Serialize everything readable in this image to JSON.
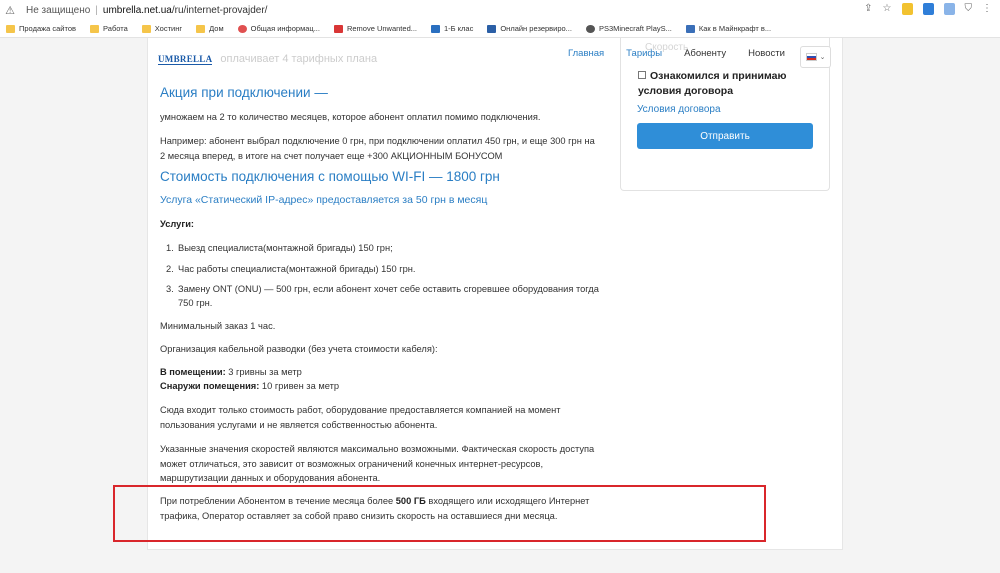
{
  "browser": {
    "security_label": "Не защищено",
    "url_host": "umbrella.net.ua",
    "url_path": "/ru/internet-provajder/",
    "bookmarks": [
      "Продажа сайтов",
      "Работа",
      "Хостинг",
      "Дом",
      "Общая информац...",
      "Remove Unwanted...",
      "1-Б клас",
      "Онлайн резервиро...",
      "PS3Minecraft PlayS...",
      "Как в Майнкрафт в..."
    ]
  },
  "header": {
    "logo_text": "UMBRELLA",
    "faded_text": "оплачивает 4 тарифных плана",
    "nav": [
      "Главная",
      "Тарифы",
      "Абоненту",
      "Новости"
    ]
  },
  "sidebar": {
    "faded_label": "Скорость",
    "agree_text": "Ознакомился и принимаю условия договора",
    "terms_link": "Условия договора",
    "submit_label": "Отправить"
  },
  "main": {
    "promo_title": "Акция при подключении —",
    "promo_p1": "умножаем на 2 то количество месяцев, которое абонент оплатил помимо подключения.",
    "promo_p2_l1": "Например: абонент выбрал подключение 0 грн, при подключении оплатил 450 грн, и еще 300 грн на",
    "promo_p2_l2": "2 месяца вперед, в итоге на счет получает еще +300 АКЦИОННЫМ БОНУСОМ",
    "wifi_title": "Стоимость подключения с помощью WI-FI — 1800 грн",
    "ip_service": "Услуга «Статический IP-адрес» предоставляется за 50 грн в месяц",
    "services_label": "Услуги:",
    "services": [
      {
        "num": "1.",
        "l1": "Выезд специалиста(монтажной бригады) 150 грн;",
        "l2": ""
      },
      {
        "num": "2.",
        "l1": "Час работы специалиста(монтажной бригады) 150 грн.",
        "l2": ""
      },
      {
        "num": "3.",
        "l1": "Замену ONT (ONU) — 500 грн, если абонент хочет себе оставить сгоревшее оборудования тогда",
        "l2": "750 грн."
      }
    ],
    "min_order": "Минимальный заказ 1 час.",
    "cabling": "Организация кабельной разводки (без учета стоимости кабеля):",
    "indoor_label": "В помещении:",
    "indoor_value": " 3 гривны за метр",
    "outdoor_label": "Снаружи помещения:",
    "outdoor_value": " 10 гривен за метр",
    "note1_l1": "Сюда входит только стоимость работ, оборудование предоставляется компанией на момент",
    "note1_l2": "пользования услугами и не является собственностью абонента.",
    "note2_l1": "Указанные значения скоростей являются максимально возможными. Фактическая скорость доступа",
    "note2_l2": "может отличаться, это зависит от возможных ограничений конечных интернет-ресурсов,",
    "note2_l3": "маршрутизации данных и оборудования абонента.",
    "limit_pre": "При потреблении Абонентом в течение месяца более ",
    "limit_bold": "500 ГБ",
    "limit_post": " входящего или исходящего Интернет",
    "limit_l2": "трафика, Оператор оставляет за собой право снизить скорость на оставшиеся дни месяца."
  },
  "colors": {
    "accent": "#2a7ec4",
    "button": "#2f8ed8",
    "highlight": "#d9262b"
  }
}
